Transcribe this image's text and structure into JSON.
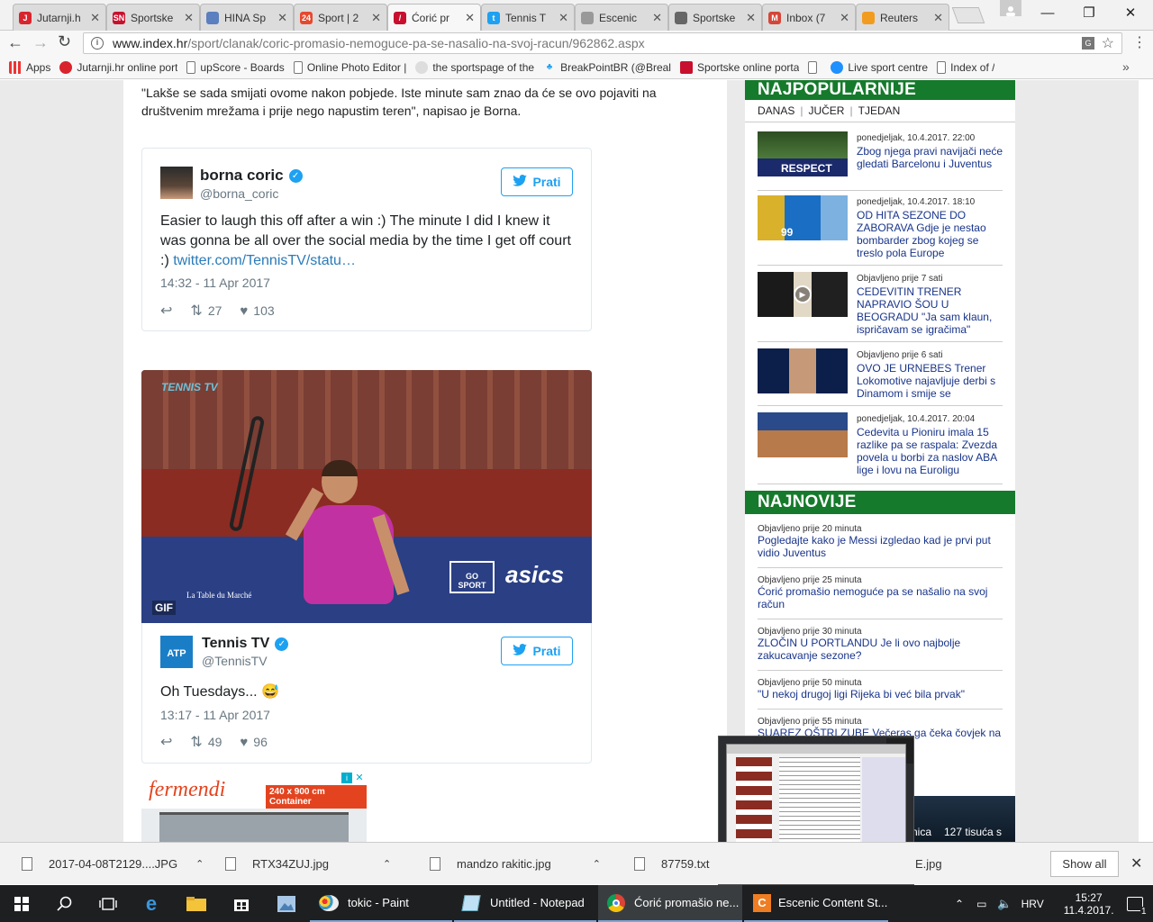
{
  "browser": {
    "tabs": [
      {
        "label": "Jutarnji.h",
        "color": "#d9232d",
        "glyph": "J"
      },
      {
        "label": "Sportske",
        "color": "#c8102e",
        "glyph": "SN"
      },
      {
        "label": "HINA Sp",
        "color": "#5b7fbf",
        "glyph": ""
      },
      {
        "label": "Sport | 2",
        "color": "#e6492d",
        "glyph": "24"
      },
      {
        "label": "Ćorić pr",
        "color": "#c8102e",
        "glyph": "/"
      },
      {
        "label": "Tennis T",
        "color": "#1da1f2",
        "glyph": "t"
      },
      {
        "label": "Escenic",
        "color": "#999999",
        "glyph": ""
      },
      {
        "label": "Sportske",
        "color": "#666666",
        "glyph": ""
      },
      {
        "label": "Inbox (7",
        "color": "#d44638",
        "glyph": "M"
      },
      {
        "label": "Reuters",
        "color": "#f29c1f",
        "glyph": ""
      }
    ],
    "url": "www.index.hr/sport/clanak/coric-promasio-nemoguce-pa-se-nasalio-na-svoj-racun/962862.aspx",
    "url_domain": "www.index.hr",
    "url_path": "/sport/clanak/coric-promasio-nemoguce-pa-se-nasalio-na-svoj-racun/962862.aspx",
    "bookmarks": [
      {
        "label": "Apps",
        "icon": "apps-icon"
      },
      {
        "label": "Jutarnji.hr online port",
        "icon": "jutarnji-icon"
      },
      {
        "label": "upScore - Boards",
        "icon": "page-icon"
      },
      {
        "label": "Online Photo Editor |",
        "icon": "page-icon"
      },
      {
        "label": "the sportspage of the",
        "icon": "reddit-icon"
      },
      {
        "label": "BreakPointBR (@Breal",
        "icon": "twitter-icon"
      },
      {
        "label": "Sportske online porta",
        "icon": "sn-icon"
      },
      {
        "label": "",
        "icon": "page-icon"
      },
      {
        "label": "Live sport centre",
        "icon": "live-icon"
      },
      {
        "label": "Index of /",
        "icon": "page-icon"
      }
    ]
  },
  "article": {
    "quote": "\"Lakše se sada smijati ovome nakon pobjede. Iste minute sam znao da će se ovo pojaviti na društvenim mrežama i prije nego napustim teren\", napisao je Borna.",
    "tweet1": {
      "name": "borna coric",
      "handle": "@borna_coric",
      "follow": "Prati",
      "text": "Easier to laugh this off after a win :) The minute I did I knew it was gonna be all over the social media by the time I get off court :) ",
      "link": "twitter.com/TennisTV/statu…",
      "time": "14:32 - 11 Apr 2017",
      "retweets": "27",
      "likes": "103"
    },
    "gif": {
      "watermark": "TENNIS TV",
      "badge": "GIF",
      "sponsor1": "asics",
      "sponsor2": "GO SPORT",
      "sponsor3": "La Table du Marché"
    },
    "tweet2": {
      "name": "Tennis TV",
      "handle": "@TennisTV",
      "follow": "Prati",
      "text": "Oh Tuesdays... ",
      "emoji": "😅",
      "time": "13:17 - 11 Apr 2017",
      "retweets": "49",
      "likes": "96"
    },
    "ad": {
      "brand": "fermendi",
      "tag": "240 x 900 cm Container"
    }
  },
  "sidebar": {
    "popular_title": "NAJPOPULARNIJE",
    "popular_tabs": [
      "DANAS",
      "JUČER",
      "TJEDAN"
    ],
    "popular": [
      {
        "meta": "ponedjeljak, 10.4.2017. 22:00",
        "title": "Zbog njega pravi navijači neće gledati Barcelonu i Juventus",
        "thumb_text": "RESPECT"
      },
      {
        "meta": "ponedjeljak, 10.4.2017. 18:10",
        "title": "OD HITA SEZONE DO ZABORAVA Gdje je nestao bombarder zbog kojeg se treslo pola Europe",
        "thumb_text": "99"
      },
      {
        "meta": "Objavljeno prije 7 sati",
        "title": "CEDEVITIN TRENER NAPRAVIO ŠOU U BEOGRADU \"Ja sam klaun, ispričavam se igračima\"",
        "thumb_text": ""
      },
      {
        "meta": "Objavljeno prije 6 sati",
        "title": "OVO JE URNEBES Trener Lokomotive najavljuje derbi s Dinamom i smije se",
        "thumb_text": ""
      },
      {
        "meta": "ponedjeljak, 10.4.2017. 20:04",
        "title": "Cedevita u Pioniru imala 15 razlike pa se raspala: Zvezda povela u borbi za naslov ABA lige i lovu na Euroligu",
        "thumb_text": ""
      }
    ],
    "newest_title": "NAJNOVIJE",
    "newest": [
      {
        "meta": "Objavljeno prije 20 minuta",
        "title": "Pogledajte kako je Messi izgledao kad je prvi put vidio Juventus"
      },
      {
        "meta": "Objavljeno prije 25 minuta",
        "title": "Ćorić promašio nemoguće pa se našalio na svoj račun"
      },
      {
        "meta": "Objavljeno prije 30 minuta",
        "title": "ZLOČIN U PORTLANDU Je li ovo najbolje zakucavanje sezone?"
      },
      {
        "meta": "Objavljeno prije 50 minuta",
        "title": "\"U nekoj drugoj ligi Rijeka bi već bila prvak\""
      },
      {
        "meta": "Objavljeno prije 55 minuta",
        "title": "SUAREZ OŠTRI ZUBE Večeras ga čeka čovjek na karijeru"
      }
    ],
    "bottom_promo": "127 tisuća s",
    "bottom_promo2": "nica"
  },
  "downloads": {
    "items": [
      "2017-04-08T2129....JPG",
      "RTX34ZUJ.jpg",
      "mandzo rakitic.jpg",
      "87759.txt",
      "E.jpg"
    ],
    "show_all": "Show all"
  },
  "taskbar": {
    "apps": [
      {
        "label": "tokic - Paint"
      },
      {
        "label": "Untitled - Notepad"
      },
      {
        "label": "Ćorić promašio ne..."
      },
      {
        "label": "Escenic Content St..."
      }
    ],
    "language": "HRV",
    "time": "15:27",
    "date": "11.4.2017.",
    "notifications": "1"
  }
}
